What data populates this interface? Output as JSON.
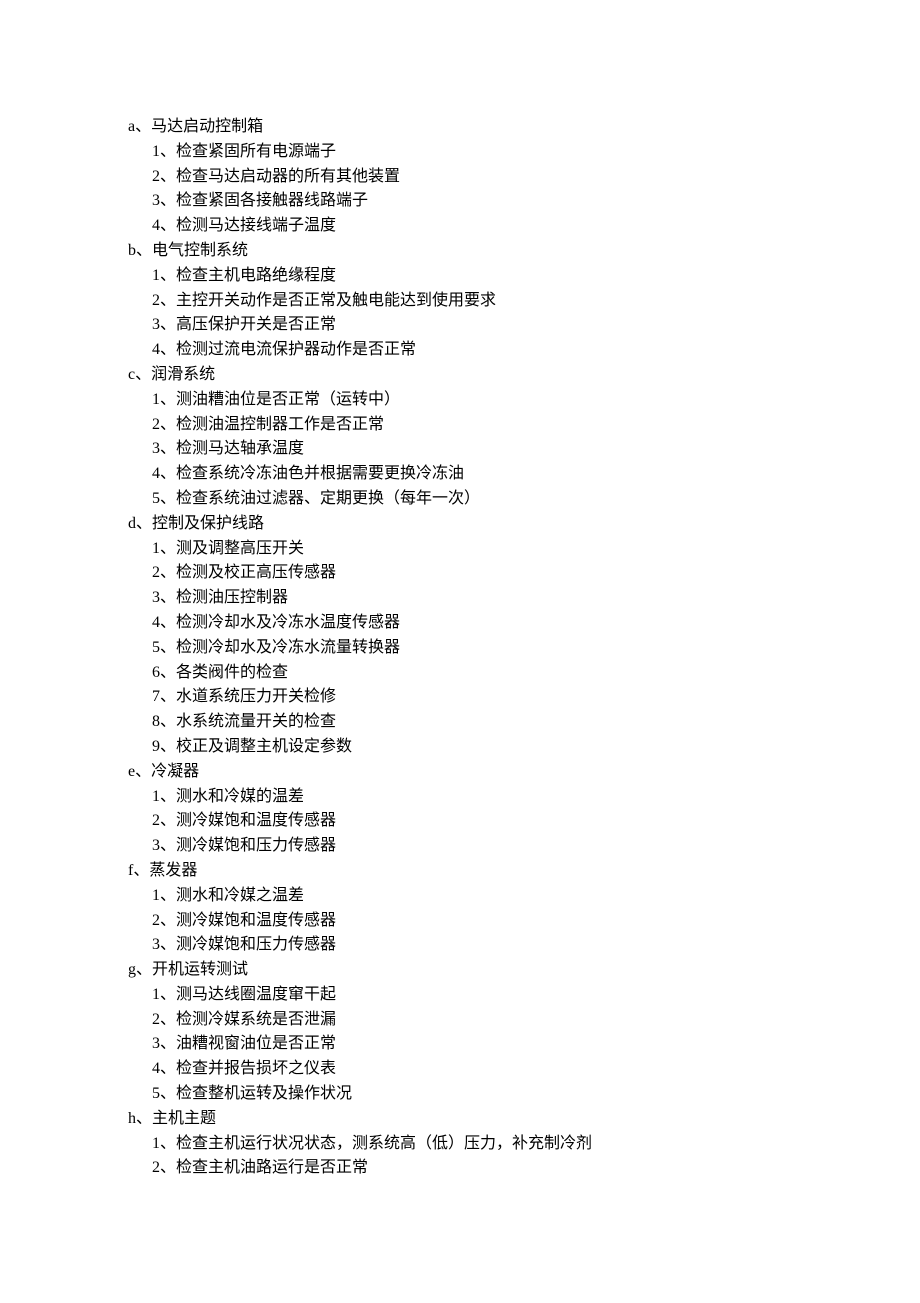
{
  "sections": [
    {
      "label": "a、马达启动控制箱",
      "items": [
        "1、检查紧固所有电源端子",
        "2、检查马达启动器的所有其他装置",
        "3、检查紧固各接触器线路端子",
        "4、检测马达接线端子温度"
      ]
    },
    {
      "label": "b、电气控制系统",
      "items": [
        "1、检查主机电路绝缘程度",
        "2、主控开关动作是否正常及触电能达到使用要求",
        "3、高压保护开关是否正常",
        "4、检测过流电流保护器动作是否正常"
      ]
    },
    {
      "label": "c、润滑系统",
      "items": [
        "1、测油糟油位是否正常（运转中）",
        "2、检测油温控制器工作是否正常",
        "3、检测马达轴承温度",
        "4、检查系统冷冻油色并根据需要更换冷冻油",
        "5、检查系统油过滤器、定期更换（每年一次）"
      ]
    },
    {
      "label": "d、控制及保护线路",
      "items": [
        "1、测及调整高压开关",
        "2、检测及校正高压传感器",
        "3、检测油压控制器",
        "4、检测冷却水及冷冻水温度传感器",
        "5、检测冷却水及冷冻水流量转换器",
        "6、各类阀件的检查",
        "7、水道系统压力开关检修",
        "8、水系统流量开关的检查",
        "9、校正及调整主机设定参数"
      ]
    },
    {
      "label": "e、冷凝器",
      "items": [
        "1、测水和冷媒的温差",
        "2、测冷媒饱和温度传感器",
        "3、测冷媒饱和压力传感器"
      ]
    },
    {
      "label": "f、蒸发器",
      "items": [
        "1、测水和冷媒之温差",
        "2、测冷媒饱和温度传感器",
        "3、测冷媒饱和压力传感器"
      ]
    },
    {
      "label": "g、开机运转测试",
      "items": [
        "1、测马达线圈温度窜干起",
        "2、检测冷媒系统是否泄漏",
        "3、油糟视窗油位是否正常",
        "4、检查并报告损坏之仪表",
        "5、检查整机运转及操作状况"
      ]
    },
    {
      "label": "h、主机主题",
      "items": [
        "1、检查主机运行状况状态，测系统高（低）压力，补充制冷剂",
        "2、检查主机油路运行是否正常"
      ]
    }
  ]
}
